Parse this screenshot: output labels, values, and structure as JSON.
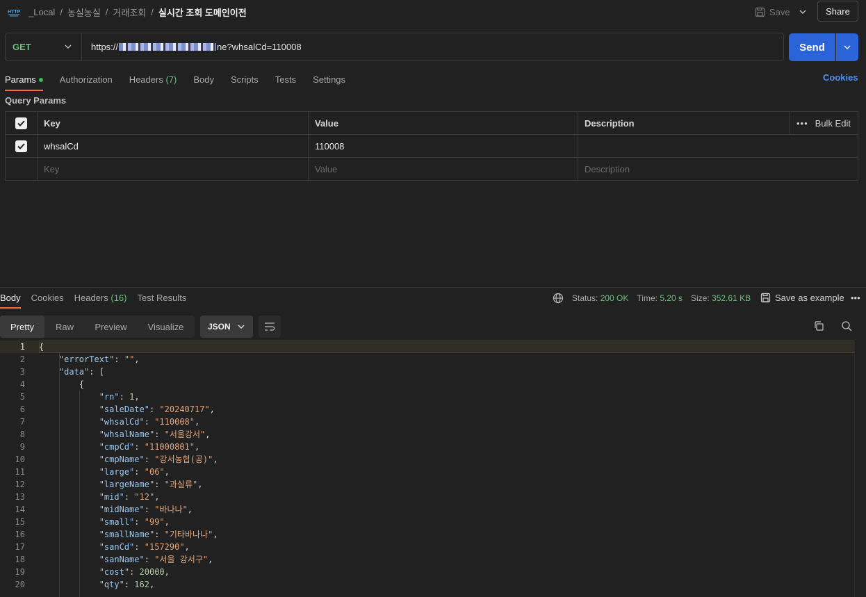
{
  "breadcrumb": {
    "items": [
      "_Local",
      "농실농실",
      "거래조회"
    ],
    "current": "실시간 조회 도메인이전"
  },
  "header": {
    "save_label": "Save",
    "share_label": "Share"
  },
  "request": {
    "method": "GET",
    "url_prefix": "https://",
    "url_suffix": "ne?whsalCd=110008",
    "send_label": "Send"
  },
  "req_tabs": {
    "params": "Params",
    "authorization": "Authorization",
    "headers": "Headers",
    "headers_count": "(7)",
    "body": "Body",
    "scripts": "Scripts",
    "tests": "Tests",
    "settings": "Settings",
    "cookies": "Cookies"
  },
  "query_params": {
    "title": "Query Params",
    "headers": {
      "key": "Key",
      "value": "Value",
      "description": "Description",
      "bulk_edit": "Bulk Edit"
    },
    "rows": [
      {
        "key": "whsalCd",
        "value": "110008",
        "description": ""
      }
    ],
    "placeholders": {
      "key": "Key",
      "value": "Value",
      "description": "Description"
    }
  },
  "response": {
    "tabs": {
      "body": "Body",
      "cookies": "Cookies",
      "headers": "Headers",
      "headers_count": "(16)",
      "test_results": "Test Results"
    },
    "status_label": "Status:",
    "status_value": "200 OK",
    "time_label": "Time:",
    "time_value": "5.20 s",
    "size_label": "Size:",
    "size_value": "352.61 KB",
    "save_example": "Save as example",
    "views": [
      "Pretty",
      "Raw",
      "Preview",
      "Visualize"
    ],
    "format": "JSON"
  },
  "code_lines": [
    {
      "n": "1",
      "t": "{"
    },
    {
      "n": "2",
      "t": "    \"errorText\": \"\","
    },
    {
      "n": "3",
      "t": "    \"data\": ["
    },
    {
      "n": "4",
      "t": "        {"
    },
    {
      "n": "5",
      "t": "            \"rn\": 1,"
    },
    {
      "n": "6",
      "t": "            \"saleDate\": \"20240717\","
    },
    {
      "n": "7",
      "t": "            \"whsalCd\": \"110008\","
    },
    {
      "n": "8",
      "t": "            \"whsalName\": \"서울강서\","
    },
    {
      "n": "9",
      "t": "            \"cmpCd\": \"11000801\","
    },
    {
      "n": "10",
      "t": "            \"cmpName\": \"강서농협(공)\","
    },
    {
      "n": "11",
      "t": "            \"large\": \"06\","
    },
    {
      "n": "12",
      "t": "            \"largeName\": \"과실류\","
    },
    {
      "n": "13",
      "t": "            \"mid\": \"12\","
    },
    {
      "n": "14",
      "t": "            \"midName\": \"바나나\","
    },
    {
      "n": "15",
      "t": "            \"small\": \"99\","
    },
    {
      "n": "16",
      "t": "            \"smallName\": \"기타바나나\","
    },
    {
      "n": "17",
      "t": "            \"sanCd\": \"157290\","
    },
    {
      "n": "18",
      "t": "            \"sanName\": \"서울 강서구\","
    },
    {
      "n": "19",
      "t": "            \"cost\": 20000,"
    },
    {
      "n": "20",
      "t": "            \"qty\": 162,"
    }
  ],
  "colors": {
    "accent_tab": "#ff6c37",
    "send": "#2b63d9",
    "get_method": "#6bbf7a",
    "link": "#4d8ef7"
  }
}
